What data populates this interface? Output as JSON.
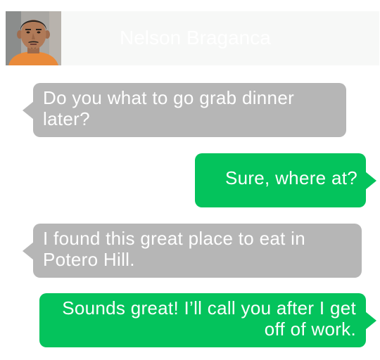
{
  "header": {
    "contact_name": "Nelson Braganca",
    "background": "#f7f8f7"
  },
  "messages": [
    {
      "direction": "incoming",
      "text": "Do you what to go grab dinner later?"
    },
    {
      "direction": "outgoing",
      "text": "Sure, where at?"
    },
    {
      "direction": "incoming",
      "text": "I found this great place to eat in Potero Hill."
    },
    {
      "direction": "outgoing",
      "text": "Sounds great! I’ll call you after I get off of work."
    }
  ],
  "colors": {
    "incoming_bubble": "#b6b6b6",
    "outgoing_bubble": "#04c35c",
    "bubble_text": "#ffffff"
  }
}
